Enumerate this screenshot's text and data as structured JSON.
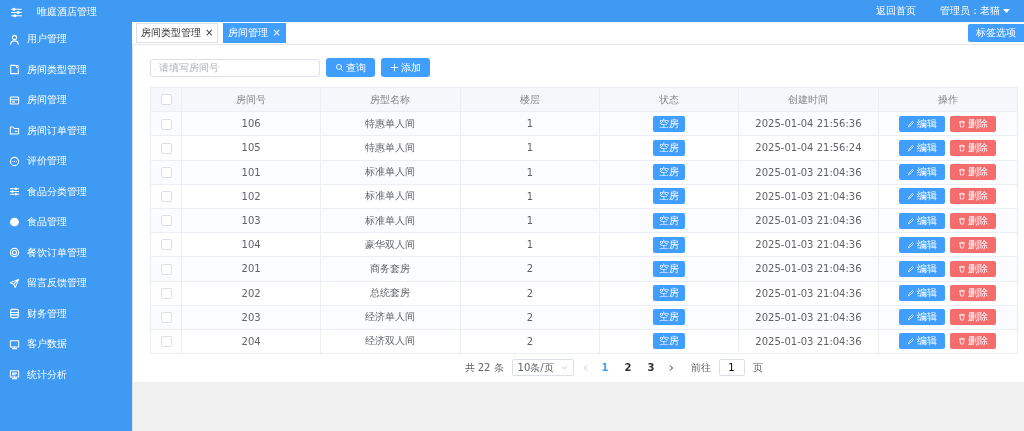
{
  "app_title": "唯庭酒店管理",
  "header": {
    "home_link": "返回首页",
    "user_menu": "管理员：老猫"
  },
  "sidebar": {
    "items": [
      {
        "label": "用户管理"
      },
      {
        "label": "房间类型管理"
      },
      {
        "label": "房间管理"
      },
      {
        "label": "房间订单管理"
      },
      {
        "label": "评价管理"
      },
      {
        "label": "食品分类管理"
      },
      {
        "label": "食品管理"
      },
      {
        "label": "餐饮订单管理"
      },
      {
        "label": "留言反馈管理"
      },
      {
        "label": "财务管理"
      },
      {
        "label": "客户数据"
      },
      {
        "label": "统计分析"
      }
    ]
  },
  "tabs": [
    {
      "label": "房间类型管理",
      "close": "×",
      "selected": false
    },
    {
      "label": "房间管理",
      "close": "×",
      "selected": true
    }
  ],
  "tab_options_button": "标签选项",
  "search": {
    "placeholder": "请填写房间号"
  },
  "buttons": {
    "search": "查询",
    "add": "添加"
  },
  "table": {
    "header_checked": false,
    "columns": [
      "房间号",
      "房型名称",
      "楼层",
      "状态",
      "创建时间",
      "操作"
    ],
    "rows": [
      {
        "checked": false,
        "room": "106",
        "type": "特惠单人间",
        "floor": "1",
        "status": "空房",
        "created": "2025-01-04 21:56:36",
        "edit": "编辑",
        "delete": "删除"
      },
      {
        "checked": false,
        "room": "105",
        "type": "特惠单人间",
        "floor": "1",
        "status": "空房",
        "created": "2025-01-04 21:56:24",
        "edit": "编辑",
        "delete": "删除"
      },
      {
        "checked": false,
        "room": "101",
        "type": "标准单人间",
        "floor": "1",
        "status": "空房",
        "created": "2025-01-03 21:04:36",
        "edit": "编辑",
        "delete": "删除"
      },
      {
        "checked": false,
        "room": "102",
        "type": "标准单人间",
        "floor": "1",
        "status": "空房",
        "created": "2025-01-03 21:04:36",
        "edit": "编辑",
        "delete": "删除"
      },
      {
        "checked": false,
        "room": "103",
        "type": "标准单人间",
        "floor": "1",
        "status": "空房",
        "created": "2025-01-03 21:04:36",
        "edit": "编辑",
        "delete": "删除"
      },
      {
        "checked": false,
        "room": "104",
        "type": "豪华双人间",
        "floor": "1",
        "status": "空房",
        "created": "2025-01-03 21:04:36",
        "edit": "编辑",
        "delete": "删除"
      },
      {
        "checked": false,
        "room": "201",
        "type": "商务套房",
        "floor": "2",
        "status": "空房",
        "created": "2025-01-03 21:04:36",
        "edit": "编辑",
        "delete": "删除"
      },
      {
        "checked": false,
        "room": "202",
        "type": "总统套房",
        "floor": "2",
        "status": "空房",
        "created": "2025-01-03 21:04:36",
        "edit": "编辑",
        "delete": "删除"
      },
      {
        "checked": false,
        "room": "203",
        "type": "经济单人间",
        "floor": "2",
        "status": "空房",
        "created": "2025-01-03 21:04:36",
        "edit": "编辑",
        "delete": "删除"
      },
      {
        "checked": false,
        "room": "204",
        "type": "经济双人间",
        "floor": "2",
        "status": "空房",
        "created": "2025-01-03 21:04:36",
        "edit": "编辑",
        "delete": "删除"
      }
    ]
  },
  "pagination": {
    "total": "共 22 条",
    "page_size": "10条/页",
    "pages": [
      {
        "label": "1",
        "selected": true
      },
      {
        "label": "2",
        "selected": false
      },
      {
        "label": "3",
        "selected": false
      }
    ],
    "goto_label": "前往",
    "goto_value": "1",
    "goto_suffix": "页"
  }
}
